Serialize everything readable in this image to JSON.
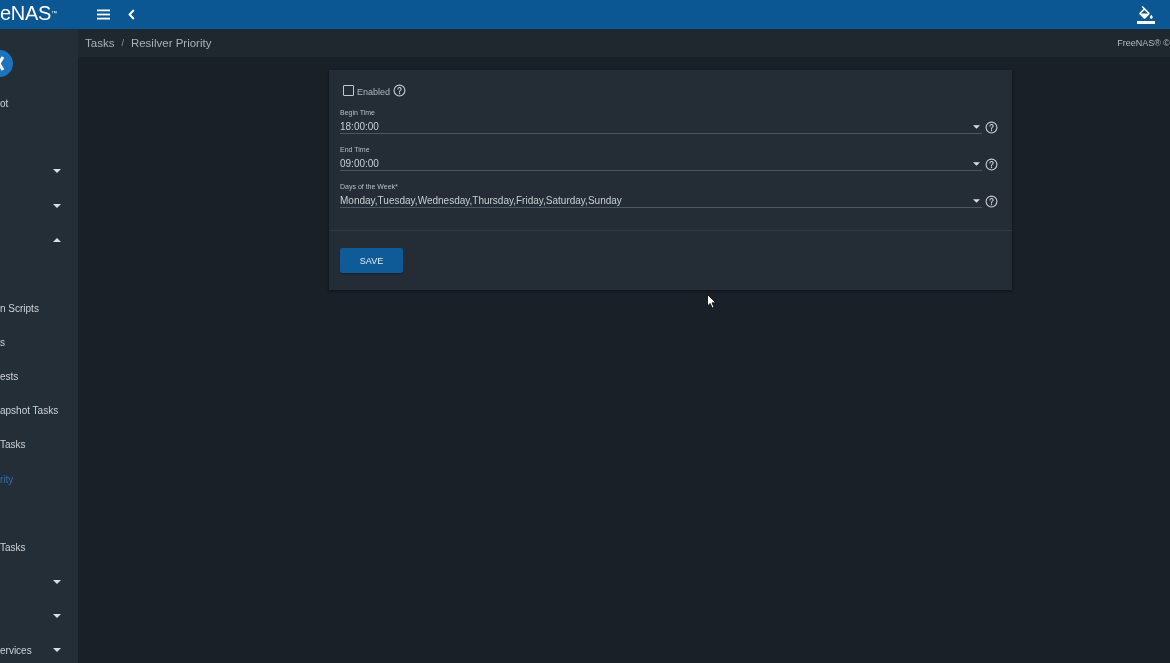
{
  "top_bar": {
    "logo": "eNAS",
    "logo_mark": "™"
  },
  "sidebar": {
    "user": "ot",
    "items": [
      {
        "kind": "group",
        "expanded": false
      },
      {
        "kind": "group",
        "expanded": false
      },
      {
        "kind": "group",
        "expanded": true,
        "children": [
          {
            "kind": "link",
            "label": "n Scripts",
            "selected": false
          },
          {
            "kind": "link",
            "label": "s",
            "selected": false
          },
          {
            "kind": "link",
            "label": "ests",
            "selected": false
          },
          {
            "kind": "link",
            "label": "apshot Tasks",
            "selected": false
          },
          {
            "kind": "link",
            "label": "Tasks",
            "selected": false
          },
          {
            "kind": "link",
            "label": "rity",
            "selected": true
          }
        ]
      },
      {
        "kind": "link",
        "label": "Tasks",
        "selected": false
      },
      {
        "kind": "group",
        "expanded": false
      },
      {
        "kind": "group",
        "expanded": false
      },
      {
        "kind": "group",
        "label": "ervices",
        "expanded": false
      }
    ]
  },
  "breadcrumb": {
    "items": [
      "Tasks",
      "Resilver Priority"
    ],
    "separator": "/",
    "copyright": "FreeNAS® ©"
  },
  "form": {
    "enabled": {
      "label": "Enabled",
      "checked": false
    },
    "fields": [
      {
        "label": "Begin Time",
        "value": "18:00:00"
      },
      {
        "label": "End Time",
        "value": "09:00:00"
      },
      {
        "label": "Days of the Week*",
        "value": "Monday,Tuesday,Wednesday,Thursday,Friday,Saturday,Sunday"
      }
    ],
    "save_button": "SAVE"
  }
}
